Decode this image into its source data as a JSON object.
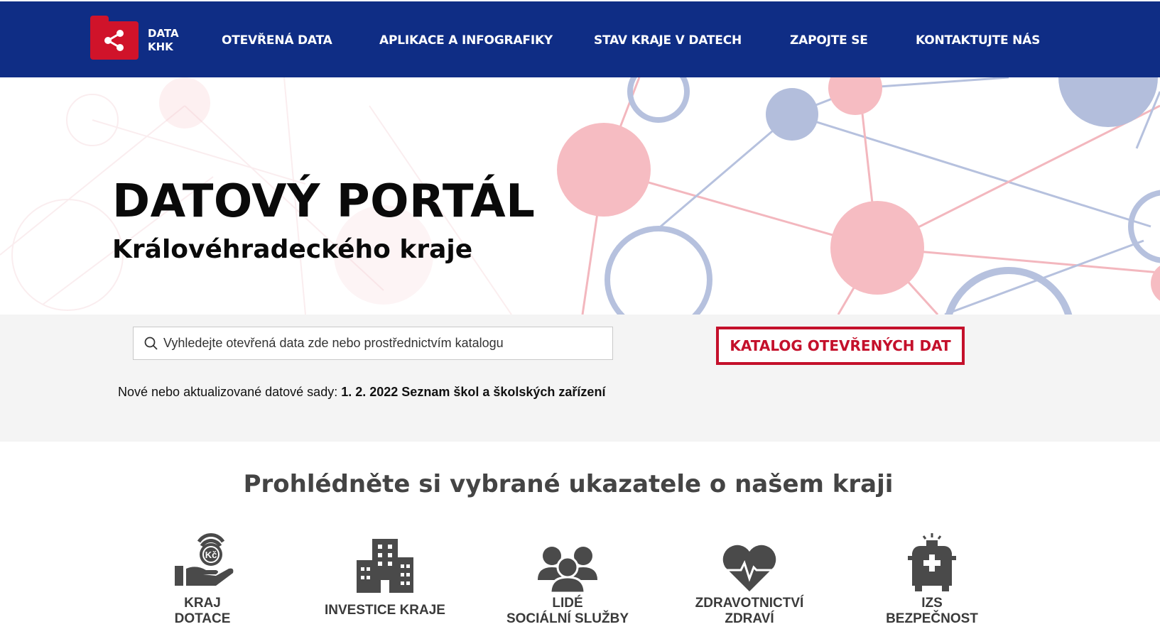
{
  "header": {
    "logo_line1": "DATA",
    "logo_line2": "KHK",
    "nav": [
      "OTEVŘENÁ DATA",
      "APLIKACE A INFOGRAFIKY",
      "STAV KRAJE V DATECH",
      "ZAPOJTE SE",
      "KONTAKTUJTE NÁS"
    ],
    "colors": {
      "bar": "#0f2d85",
      "logo": "#d0132a"
    }
  },
  "hero": {
    "title": "DATOVÝ PORTÁL",
    "subtitle": "Královéhradeckého kraje"
  },
  "search": {
    "placeholder": "Vyhledejte otevřená data zde nebo prostřednictvím katalogu",
    "icon": "search-icon",
    "catalog_button": "KATALOG OTEVŘENÝCH DAT"
  },
  "news": {
    "label": "Nové nebo aktualizované datové sady:",
    "item": "1. 2. 2022 Seznam škol a školských zařízení"
  },
  "indicators": {
    "title": "Prohlédněte si vybrané ukazatele o našem kraji",
    "tiles": [
      {
        "icon": "hand-coin-icon",
        "line1": "KRAJ",
        "line2": "DOTACE"
      },
      {
        "icon": "building-icon",
        "line1": "INVESTICE KRAJE",
        "line2": ""
      },
      {
        "icon": "people-icon",
        "line1": "LIDÉ",
        "line2": "SOCIÁLNÍ SLUŽBY"
      },
      {
        "icon": "heart-pulse-icon",
        "line1": "ZDRAVOTNICTVÍ",
        "line2": "ZDRAVÍ"
      },
      {
        "icon": "ambulance-icon",
        "line1": "IZS",
        "line2": "BEZPEČNOST"
      }
    ]
  }
}
